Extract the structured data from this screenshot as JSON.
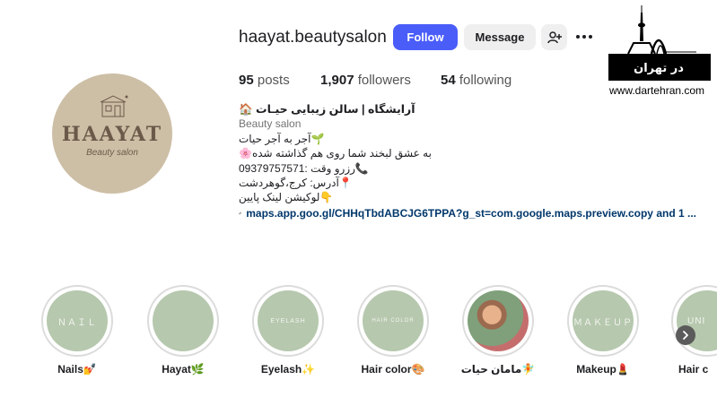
{
  "profile": {
    "username": "haayat.beautysalon",
    "follow_label": "Follow",
    "message_label": "Message",
    "avatar_logo": "HAAYAT",
    "avatar_sub": "Beauty salon"
  },
  "stats": {
    "posts_count": "95",
    "posts_label": "posts",
    "followers_count": "1,907",
    "followers_label": "followers",
    "following_count": "54",
    "following_label": "following"
  },
  "bio": {
    "name": "آرایشگاه | سالن زیبایی حیـات 🏠",
    "category": "Beauty salon",
    "line1": "🌱آجر به آجر حیات",
    "line2": "به عشق لبخند شما روی هم گذاشته شده🌸",
    "line3": "📞رزرو وقت :09379757571",
    "line4": "📍آدرس: کرج،گوهردشت",
    "line5": "👇لوکیشن لینک پایین",
    "link": "maps.app.goo.gl/CHHqTbdABCJG6TPPA?g_st=com.google.maps.preview.copy and 1 ..."
  },
  "watermark": {
    "brand": "در تهران",
    "site": "www.dartehran.com"
  },
  "highlights": [
    {
      "label": "Nails💅",
      "inner": "ＮＡＩＬ"
    },
    {
      "label": "Hayat🌿",
      "inner": ""
    },
    {
      "label": "Eyelash✨",
      "inner": "EYELASH"
    },
    {
      "label": "Hair color🎨",
      "inner": "HAIR COLOR"
    },
    {
      "label": "مامان حیات🧚",
      "inner": ""
    },
    {
      "label": "Makeup💄",
      "inner": "ＭＡＫＥＵＰ"
    },
    {
      "label": "Hair c",
      "inner": "UNI"
    }
  ],
  "colors": {
    "follow_button": "#4a5df9",
    "highlight_bg": "#b6c8ae",
    "avatar_bg": "#cdbfa6",
    "link": "#00376b"
  }
}
